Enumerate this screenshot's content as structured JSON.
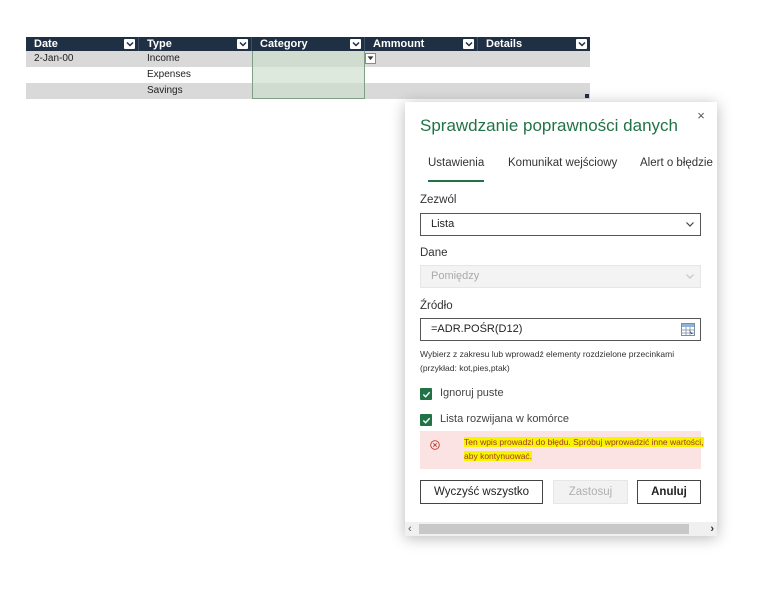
{
  "table": {
    "headers": [
      "Date",
      "Type",
      "Category",
      "Ammount",
      "Details"
    ],
    "rows": [
      [
        "2-Jan-00",
        "Income",
        "",
        "",
        ""
      ],
      [
        "",
        "Expenses",
        "",
        "",
        ""
      ],
      [
        "",
        "Savings",
        "",
        "",
        ""
      ]
    ]
  },
  "dialog": {
    "title": "Sprawdzanie poprawności danych",
    "close": "×",
    "tabs": [
      "Ustawienia",
      "Komunikat wejściowy",
      "Alert o błędzie"
    ],
    "allow_label": "Zezwól",
    "allow_value": "Lista",
    "data_label": "Dane",
    "data_value": "Pomiędzy",
    "source_label": "Źródło",
    "source_value": "=ADR.POŚR(D12)",
    "hint": "Wybierz z zakresu lub wprowadź elementy rozdzielone przecinkami (przykład: kot,pies,ptak)",
    "ignore_blank": "Ignoruj puste",
    "in_cell_dropdown": "Lista rozwijana w komórce",
    "error": "Ten wpis prowadzi do błędu. Spróbuj wprowadzić inne wartości, aby kontynuować.",
    "buttons": {
      "clear_all": "Wyczyść wszystko",
      "apply": "Zastosuj",
      "cancel": "Anuluj"
    }
  },
  "colors": {
    "header_bg": "#1f2f44",
    "accent": "#217346",
    "error_bg": "#fbe3e4",
    "highlight": "#f5f500"
  }
}
